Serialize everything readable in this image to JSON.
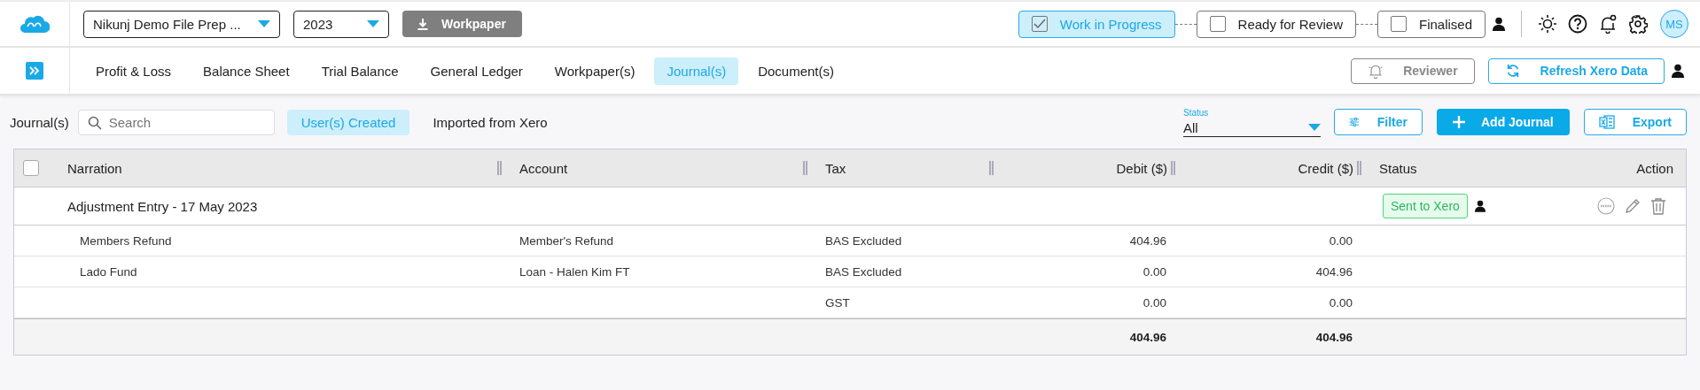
{
  "top_bar": {
    "company": "Nikunj Demo File Prep ...",
    "year": "2023",
    "workpaper_button": "Workpaper",
    "stages": [
      {
        "label": "Work in Progress",
        "checked": true,
        "selected": true
      },
      {
        "label": "Ready for Review",
        "checked": false,
        "selected": false
      },
      {
        "label": "Finalised",
        "checked": false,
        "selected": false
      }
    ],
    "avatar": "MS"
  },
  "nav": {
    "tabs": [
      {
        "label": "Profit & Loss",
        "selected": false
      },
      {
        "label": "Balance Sheet",
        "selected": false
      },
      {
        "label": "Trial Balance",
        "selected": false
      },
      {
        "label": "General Ledger",
        "selected": false
      },
      {
        "label": "Workpaper(s)",
        "selected": false
      },
      {
        "label": "Journal(s)",
        "selected": true
      },
      {
        "label": "Document(s)",
        "selected": false
      }
    ],
    "reviewer_button": "Reviewer",
    "refresh_button": "Refresh Xero Data"
  },
  "toolbar": {
    "title": "Journal(s)",
    "search": {
      "placeholder": "Search"
    },
    "filters": [
      {
        "label": "User(s) Created",
        "selected": true
      },
      {
        "label": "Imported from Xero",
        "selected": false
      }
    ],
    "status": {
      "label": "Status",
      "value": "All"
    },
    "filter_button": "Filter",
    "add_button": "Add Journal",
    "export_button": "Export"
  },
  "table": {
    "select_all": {
      "checked": false
    },
    "columns": [
      "Narration",
      "Account",
      "Tax",
      "Debit ($)",
      "Credit ($)",
      "Status",
      "Action"
    ],
    "groups": [
      {
        "title": "Adjustment Entry - 17 May 2023",
        "status": "Sent to Xero",
        "rows": [
          {
            "narration": "Members Refund",
            "account": "Member's Refund",
            "tax": "BAS Excluded",
            "debit": "404.96",
            "credit": "0.00"
          },
          {
            "narration": "Lado Fund",
            "account": "Loan - Halen Kim FT",
            "tax": "BAS Excluded",
            "debit": "0.00",
            "credit": "404.96"
          },
          {
            "narration": "",
            "account": "",
            "tax": "GST",
            "debit": "0.00",
            "credit": "0.00"
          }
        ]
      }
    ],
    "total": {
      "debit": "404.96",
      "credit": "404.96"
    }
  }
}
